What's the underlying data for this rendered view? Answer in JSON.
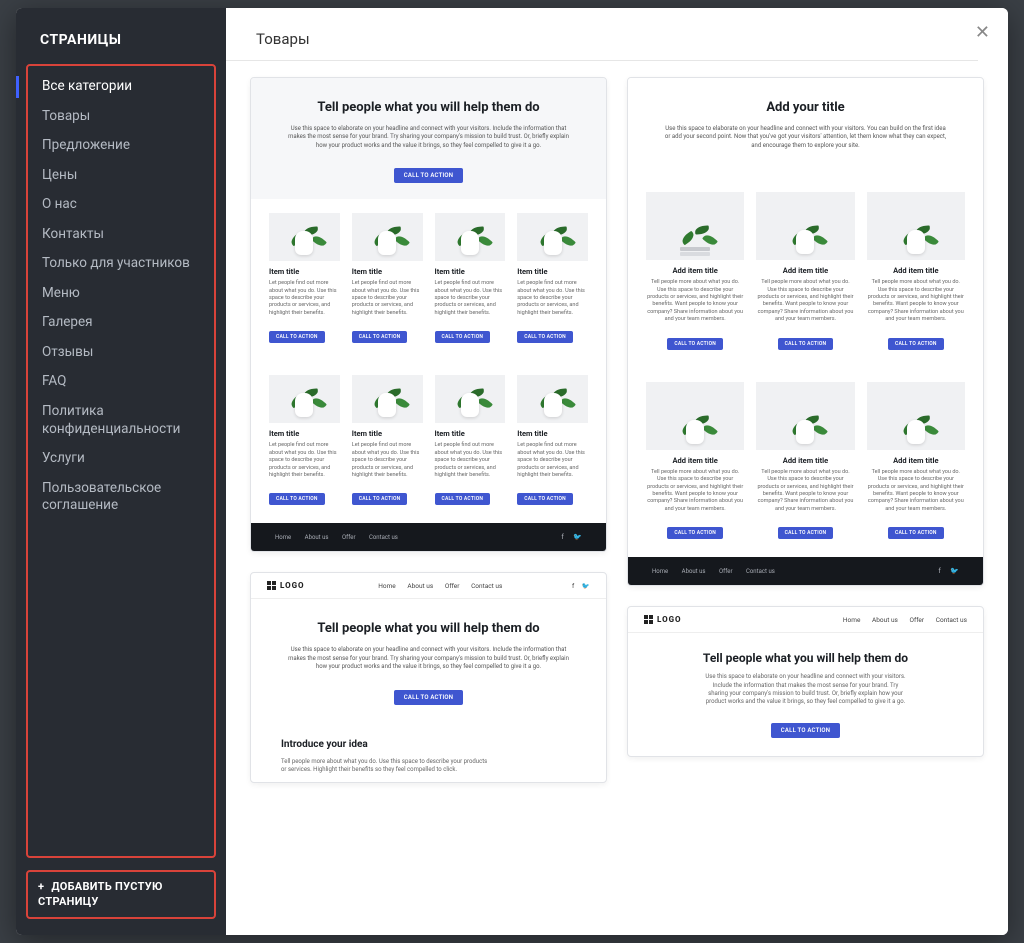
{
  "sidebar": {
    "title": "СТРАНИЦЫ",
    "categories": [
      "Все категории",
      "Товары",
      "Предложение",
      "Цены",
      "О нас",
      "Контакты",
      "Только для участников",
      "Меню",
      "Галерея",
      "Отзывы",
      "FAQ",
      "Политика конфиденциальности",
      "Услуги",
      "Пользовательское соглашение"
    ],
    "active_index": 0,
    "add_button": "ДОБАВИТЬ ПУСТУЮ СТРАНИЦУ"
  },
  "main": {
    "title": "Товары"
  },
  "preview": {
    "hero_title": "Tell people what you will help them do",
    "hero_sub": "Use this space to elaborate on your headline and connect with your visitors. Include the information that makes the most sense for your brand. Try sharing your company's mission to build trust. Or, briefly explain how your product works and the value it brings, so they feel compelled to give it a go.",
    "hero_title2": "Add your title",
    "hero_sub2": "Use this space to elaborate on your headline and connect with your visitors. You can build on the first idea or add your second point. Now that you've got your visitors' attention, let them know what they can expect, and encourage them to explore your site.",
    "cta": "CALL TO ACTION",
    "item_title": "Item title",
    "item_desc": "Let people find out more about what you do. Use this space to describe your products or services, and highlight their benefits.",
    "add_item_title": "Add item title",
    "add_item_desc": "Tell people more about what you do. Use this space to describe your products or services, and highlight their benefits. Want people to know your company? Share information about you and your team members.",
    "intro_title": "Introduce your idea",
    "intro_desc": "Tell people more about what you do. Use this space to describe your products or services. Highlight their benefits so they feel compelled to click.",
    "footer_links": [
      "Home",
      "About us",
      "Offer",
      "Contact us"
    ],
    "logo_text": "LOGO"
  }
}
